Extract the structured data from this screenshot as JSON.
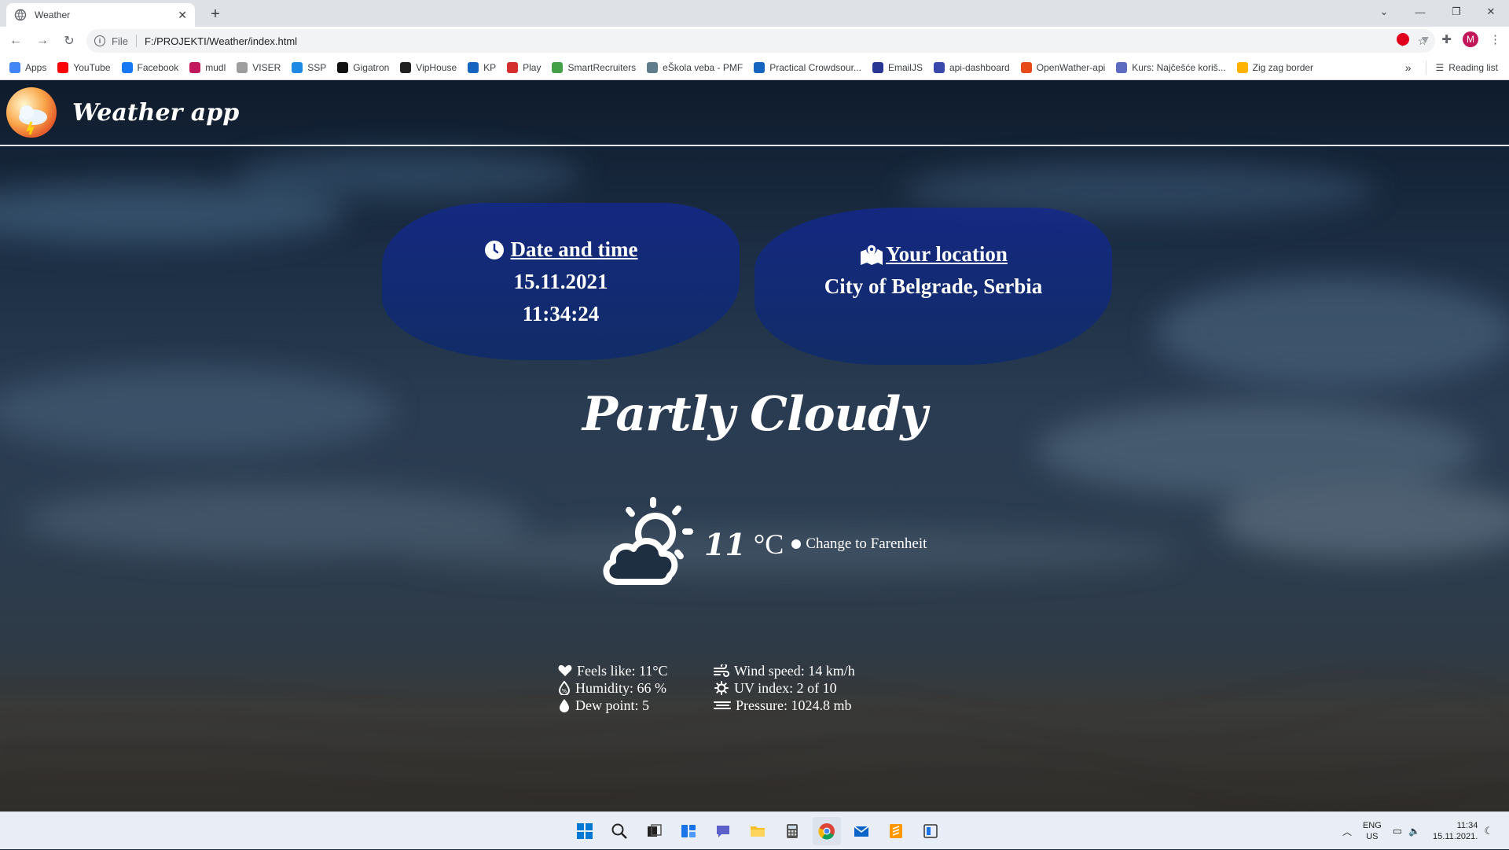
{
  "browser": {
    "tab_title": "Weather",
    "tab_close": "✕",
    "new_tab": "+",
    "url_scheme_label": "File",
    "url": "F:/PROJEKTI/Weather/index.html",
    "profile_initial": "M",
    "bookmarks": [
      {
        "label": "Apps",
        "icon": "apps-grid-icon",
        "color": "#4285f4"
      },
      {
        "label": "YouTube",
        "icon": "youtube-icon",
        "color": "#ff0000"
      },
      {
        "label": "Facebook",
        "icon": "facebook-icon",
        "color": "#1877f2"
      },
      {
        "label": "mudl",
        "icon": "mudl-icon",
        "color": "#c2185b"
      },
      {
        "label": "VISER",
        "icon": "viser-icon",
        "color": "#9e9e9e"
      },
      {
        "label": "SSP",
        "icon": "ssp-icon",
        "color": "#1e88e5"
      },
      {
        "label": "Gigatron",
        "icon": "gigatron-icon",
        "color": "#111111"
      },
      {
        "label": "VipHouse",
        "icon": "viphouse-icon",
        "color": "#212121"
      },
      {
        "label": "KP",
        "icon": "kp-icon",
        "color": "#1565c0"
      },
      {
        "label": "Play",
        "icon": "play-icon",
        "color": "#d32f2f"
      },
      {
        "label": "SmartRecruiters",
        "icon": "smartrecruiters-icon",
        "color": "#43a047"
      },
      {
        "label": "eŠkola veba - PMF",
        "icon": "eskola-icon",
        "color": "#607d8b"
      },
      {
        "label": "Practical Crowdsour...",
        "icon": "practical-icon",
        "color": "#1565c0"
      },
      {
        "label": "EmailJS",
        "icon": "emailjs-icon",
        "color": "#283593"
      },
      {
        "label": "api-dashboard",
        "icon": "api-dashboard-icon",
        "color": "#3949ab"
      },
      {
        "label": "OpenWather-api",
        "icon": "openweather-icon",
        "color": "#e64a19"
      },
      {
        "label": "Kurs: Najčešće koriš...",
        "icon": "kurs-icon",
        "color": "#5c6bc0"
      },
      {
        "label": "Zig zag border",
        "icon": "zigzag-icon",
        "color": "#ffb300"
      }
    ],
    "more_bookmarks": "»",
    "reading_list": "Reading list"
  },
  "app": {
    "title": "Weather app",
    "date_card": {
      "title": "Date and time",
      "date": "15.11.2021",
      "time": "11:34:24"
    },
    "location_card": {
      "title": "Your location",
      "location": "City of Belgrade, Serbia"
    },
    "condition": "Partly Cloudy",
    "temperature": "11",
    "unit": "°C",
    "toggle_label": "Change to Farenheit",
    "details": {
      "feels_like": "Feels like: 11°C",
      "humidity": "Humidity: 66 %",
      "dew_point": "Dew point: 5",
      "wind_speed": "Wind speed: 14 km/h",
      "uv_index": "UV index: 2 of 10",
      "pressure": "Pressure: 1024.8 mb"
    }
  },
  "taskbar": {
    "lang_top": "ENG",
    "lang_bottom": "US",
    "time": "11:34",
    "date": "15.11.2021."
  }
}
